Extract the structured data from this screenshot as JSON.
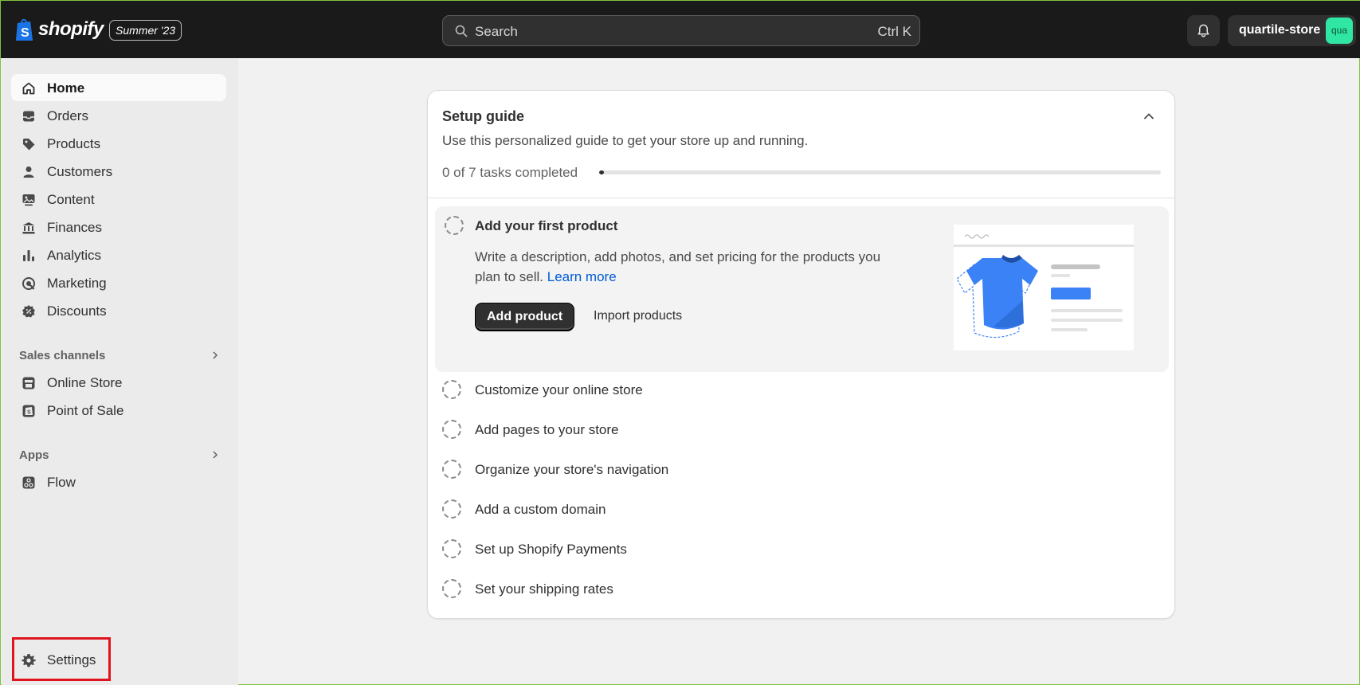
{
  "topbar": {
    "brand": "shopify",
    "edition_badge": "Summer '23",
    "search_placeholder": "Search",
    "search_shortcut": "Ctrl K",
    "store_name": "quartile-store",
    "avatar_text": "qua"
  },
  "sidebar": {
    "items": [
      {
        "label": "Home",
        "icon": "home-icon",
        "active": true
      },
      {
        "label": "Orders",
        "icon": "inbox-icon"
      },
      {
        "label": "Products",
        "icon": "tag-icon"
      },
      {
        "label": "Customers",
        "icon": "person-icon"
      },
      {
        "label": "Content",
        "icon": "image-icon"
      },
      {
        "label": "Finances",
        "icon": "bank-icon"
      },
      {
        "label": "Analytics",
        "icon": "bar-chart-icon"
      },
      {
        "label": "Marketing",
        "icon": "target-icon"
      },
      {
        "label": "Discounts",
        "icon": "discount-icon"
      }
    ],
    "sales_channels_label": "Sales channels",
    "sales_channels": [
      {
        "label": "Online Store",
        "icon": "store-icon"
      },
      {
        "label": "Point of Sale",
        "icon": "pos-icon"
      }
    ],
    "apps_label": "Apps",
    "apps": [
      {
        "label": "Flow",
        "icon": "flow-icon"
      }
    ],
    "settings_label": "Settings"
  },
  "setup_guide": {
    "title": "Setup guide",
    "subtitle": "Use this personalized guide to get your store up and running.",
    "progress_text": "0 of 7 tasks completed",
    "progress_completed": 0,
    "progress_total": 7,
    "expanded_task": {
      "title": "Add your first product",
      "description": "Write a description, add photos, and set pricing for the products you plan to sell.",
      "link_text": "Learn more",
      "primary_button": "Add product",
      "secondary_button": "Import products"
    },
    "tasks": [
      "Customize your online store",
      "Add pages to your store",
      "Organize your store's navigation",
      "Add a custom domain",
      "Set up Shopify Payments",
      "Set your shipping rates"
    ]
  },
  "colors": {
    "topbar_bg": "#1a1a1a",
    "sidebar_bg": "#ebebeb",
    "link": "#005bd3",
    "avatar": "#2fe7a2",
    "highlight_box": "#e0141e",
    "shirt": "#3b82f6"
  }
}
